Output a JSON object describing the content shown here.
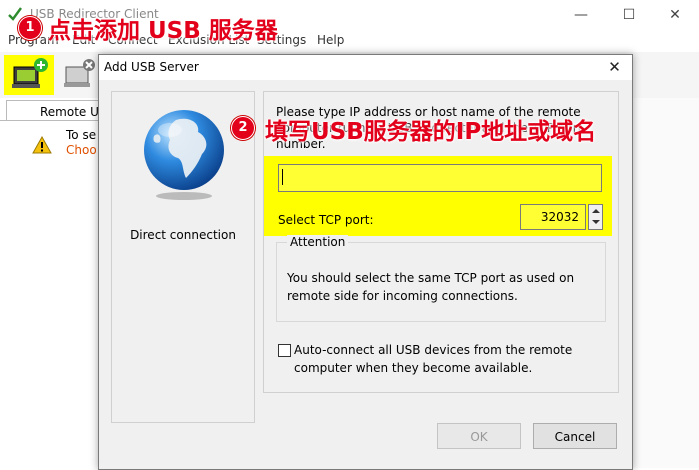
{
  "main_window": {
    "title": "USB Redirector Client",
    "controls": {
      "minimize": "—",
      "maximize": "☐",
      "close": "✕"
    },
    "menu": [
      "Program",
      "Edit",
      "Connect",
      "Exclusion List",
      "Settings",
      "Help"
    ],
    "tab_label": "Remote U",
    "info_line1": "To se",
    "info_line2": "Choo"
  },
  "annotations": {
    "step1_number": "1",
    "step1_text": "点击添加 USB 服务器",
    "step2_number": "2",
    "step2_text": "填写USB服务器的IP地址或域名",
    "color": "#e2001a",
    "highlight_color": "#ffff00"
  },
  "dialog": {
    "title": "Add USB Server",
    "close": "✕",
    "connection_type": "Direct connection",
    "instruction": "Please type IP address or host name of the remote computer running USB Redirector and the TCP port number.",
    "host_value": "",
    "port_label": "Select TCP port:",
    "port_value": "32032",
    "attention_title": "Attention",
    "attention_text": "You should select the same TCP port as used on remote side for incoming connections.",
    "autoconnect_label": "Auto-connect all USB devices from the remote computer when they become available.",
    "autoconnect_checked": false,
    "ok_label": "OK",
    "cancel_label": "Cancel"
  }
}
